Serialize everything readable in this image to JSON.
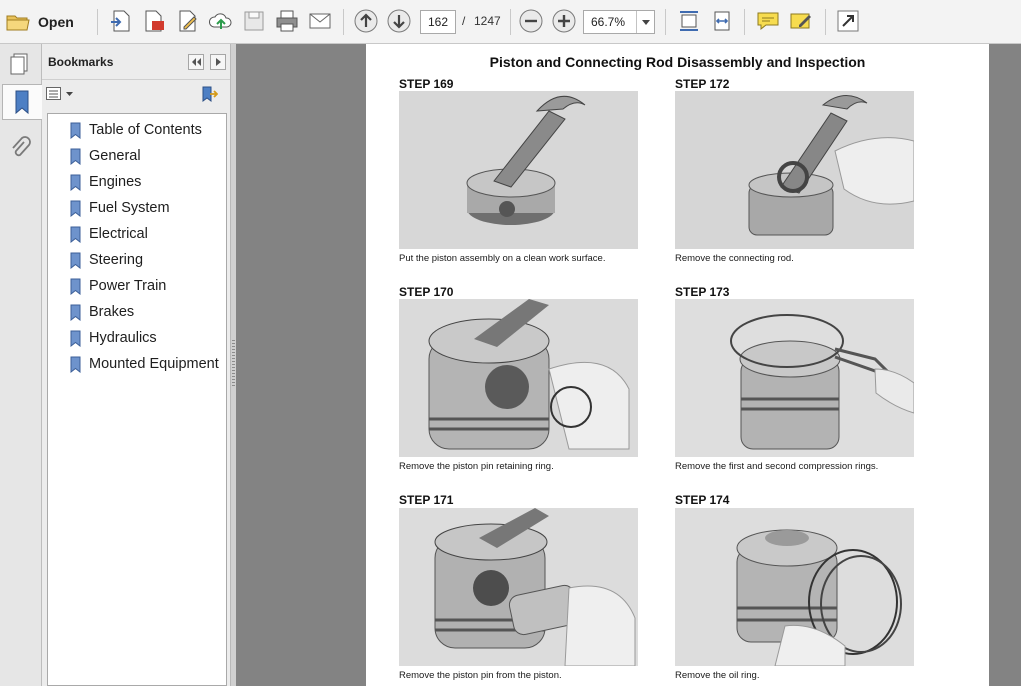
{
  "toolbar": {
    "open_label": "Open",
    "page_current": "162",
    "page_separator": "/",
    "page_total": "1247",
    "zoom_value": "66.7%"
  },
  "sidebar": {
    "panel_title": "Bookmarks",
    "bookmarks": [
      "Table of Contents",
      "General",
      "Engines",
      "Fuel System",
      "Electrical",
      "Steering",
      "Power Train",
      "Brakes",
      "Hydraulics",
      "Mounted Equipment"
    ]
  },
  "document": {
    "title": "Piston and Connecting Rod Disassembly and Inspection",
    "steps": [
      {
        "label": "STEP 169",
        "caption": "Put the piston assembly on a clean work surface."
      },
      {
        "label": "STEP 172",
        "caption": "Remove the connecting rod."
      },
      {
        "label": "STEP 170",
        "caption": "Remove the piston pin retaining ring."
      },
      {
        "label": "STEP 173",
        "caption": "Remove the first and second compression rings."
      },
      {
        "label": "STEP 171",
        "caption": "Remove the piston pin from the piston."
      },
      {
        "label": "STEP 174",
        "caption": "Remove the oil ring."
      }
    ]
  },
  "colors": {
    "doc_background": "#838383",
    "page": "#ffffff",
    "toolbar": "#f3f3f3",
    "accent_blue": "#3f6bb0"
  }
}
